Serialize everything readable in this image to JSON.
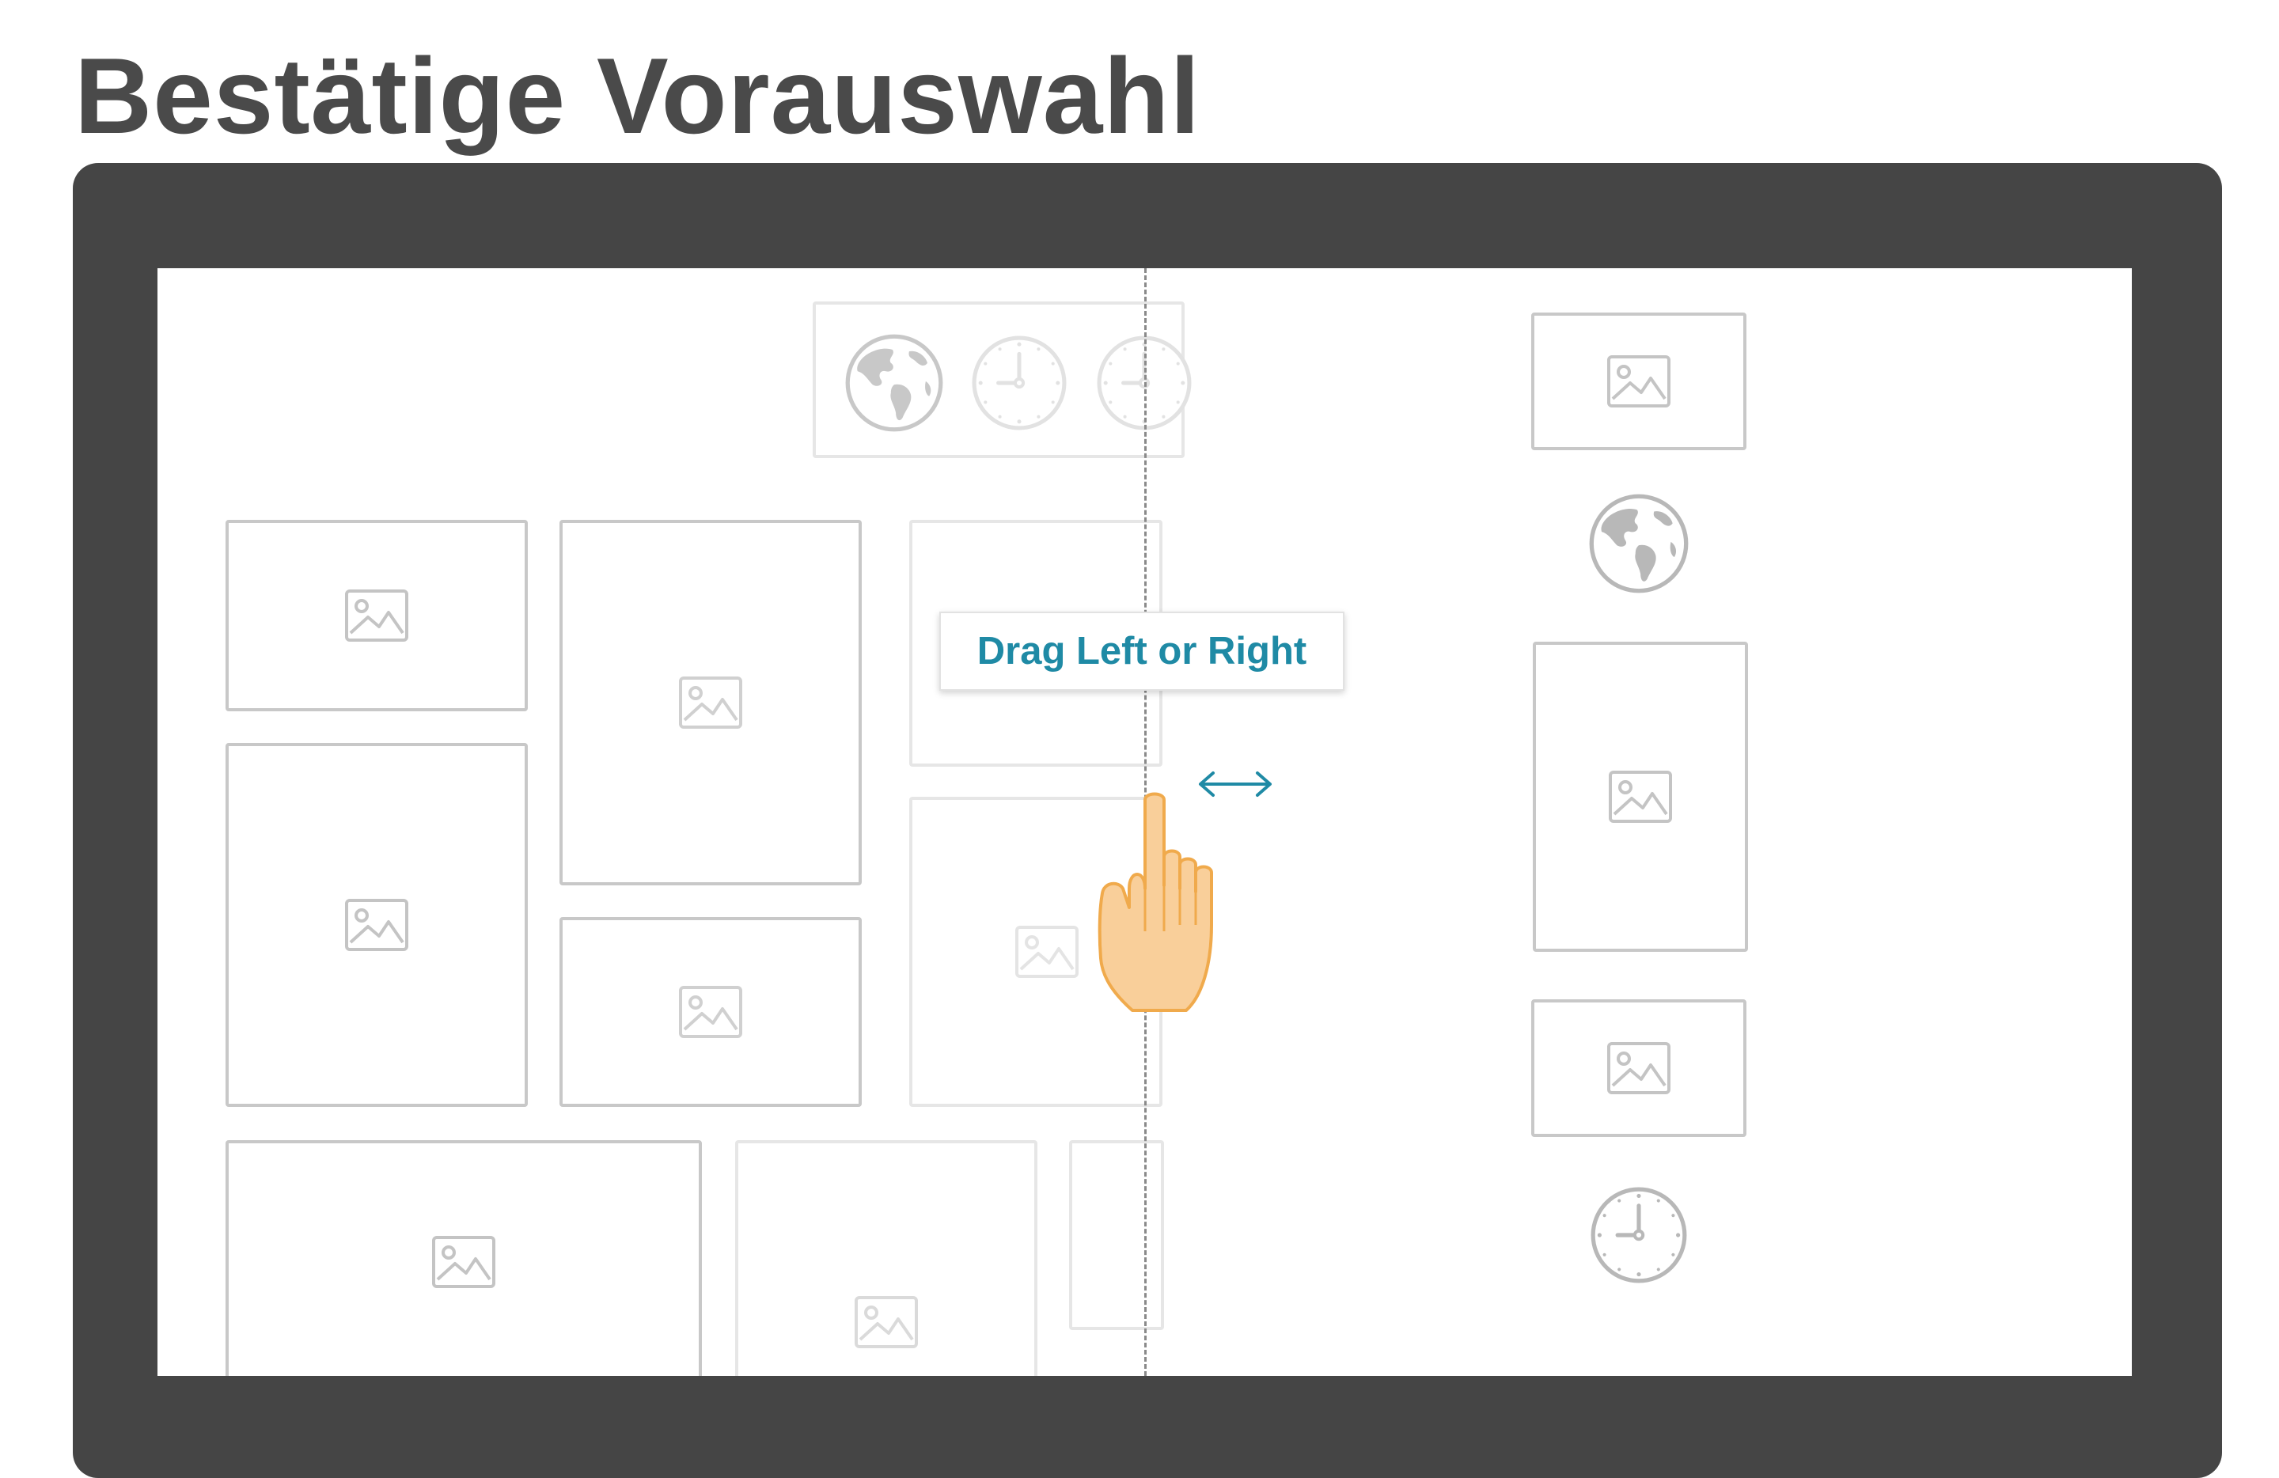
{
  "page": {
    "title": "Bestätige Vorauswahl"
  },
  "screen": {
    "hint_label": "Drag Left or Right"
  },
  "icons": {
    "image_placeholder": "image-icon",
    "globe": "globe-icon",
    "clock": "clock-icon",
    "drag_arrow": "double-arrow-icon",
    "pointer": "hand-pointer-icon"
  },
  "colors": {
    "device_frame": "#454545",
    "hint_text": "#1f8aa5",
    "hand_fill": "#f9cf9a",
    "hand_outline": "#f0aa4c",
    "placeholder_stroke": "#c8c8c8"
  }
}
